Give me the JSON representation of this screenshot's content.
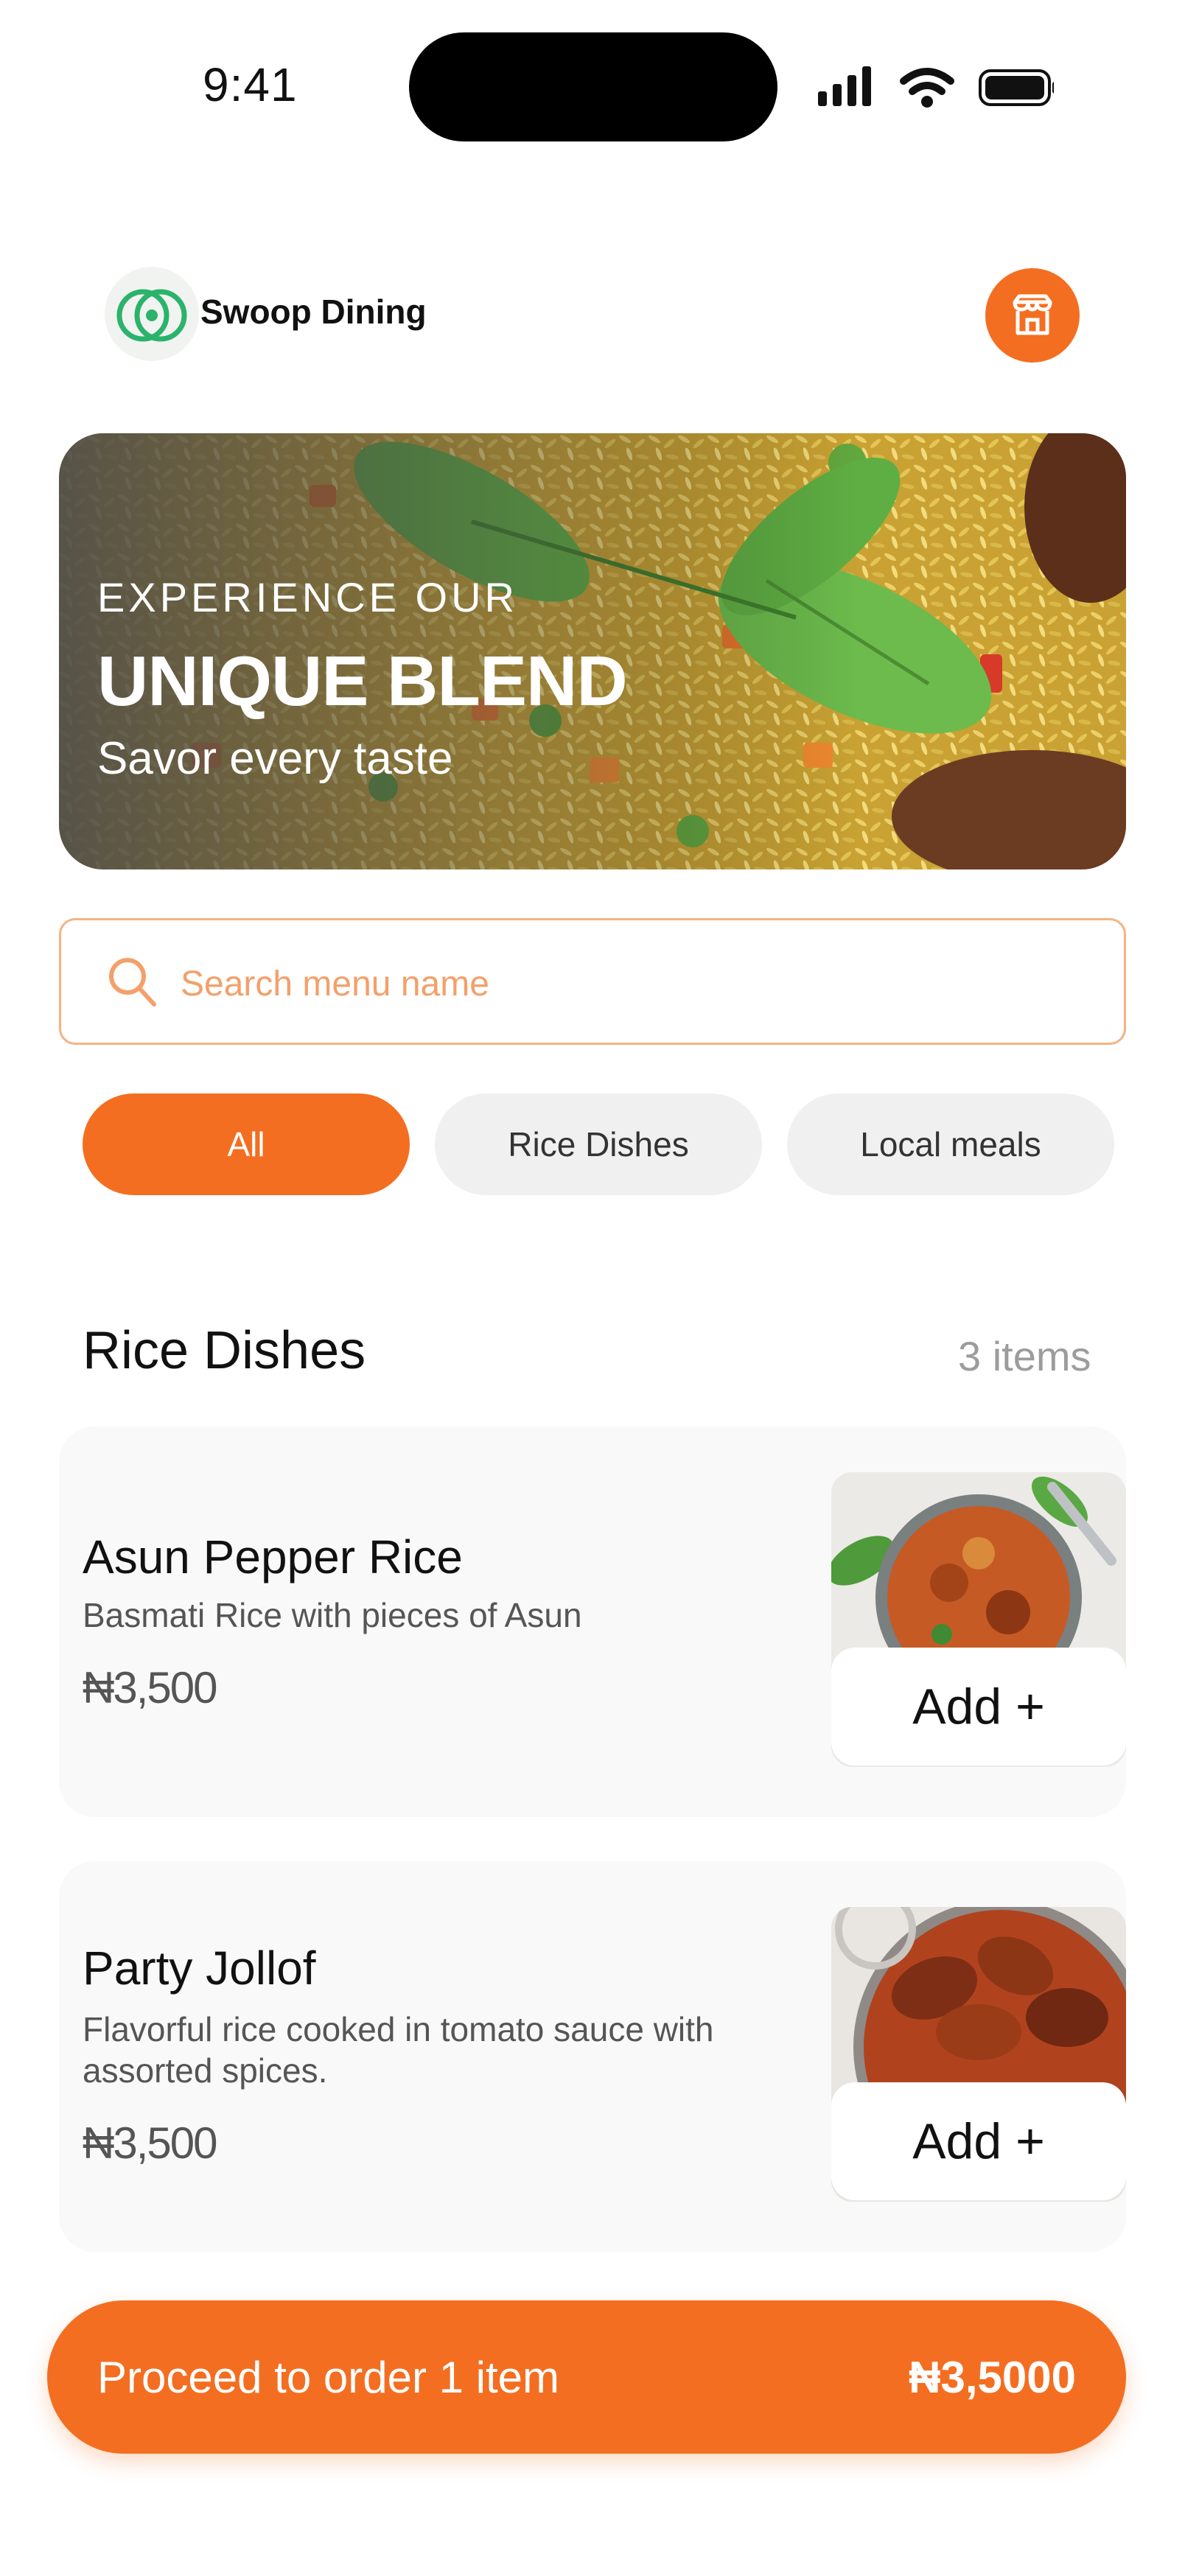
{
  "status_bar": {
    "time": "9:41"
  },
  "header": {
    "brand": "Swoop Dining"
  },
  "hero": {
    "eyebrow": "EXPERIENCE OUR",
    "title": "UNIQUE BLEND",
    "subtitle": "Savor every taste"
  },
  "search": {
    "placeholder": "Search menu name"
  },
  "filters": [
    {
      "label": "All",
      "active": true
    },
    {
      "label": "Rice Dishes",
      "active": false
    },
    {
      "label": "Local meals",
      "active": false
    }
  ],
  "section": {
    "title": "Rice Dishes",
    "count": "3 items"
  },
  "menu_items": [
    {
      "name": "Asun Pepper Rice",
      "description": "Basmati Rice with pieces of Asun",
      "price": "₦3,500",
      "add_label": "Add +"
    },
    {
      "name": "Party Jollof",
      "description": "Flavorful rice cooked in tomato sauce with assorted spices.",
      "price": "₦3,500",
      "add_label": "Add +"
    }
  ],
  "order_bar": {
    "label": "Proceed to order 1 item",
    "total": "₦3,5000"
  },
  "colors": {
    "accent": "#f46e21",
    "brand_green": "#2bb36b",
    "card_bg": "#f9f9f9",
    "chip_inactive": "#f0f0f0"
  },
  "icons": [
    "signal-icon",
    "wifi-icon",
    "battery-icon",
    "brand-logo-icon",
    "store-icon",
    "search-icon"
  ]
}
